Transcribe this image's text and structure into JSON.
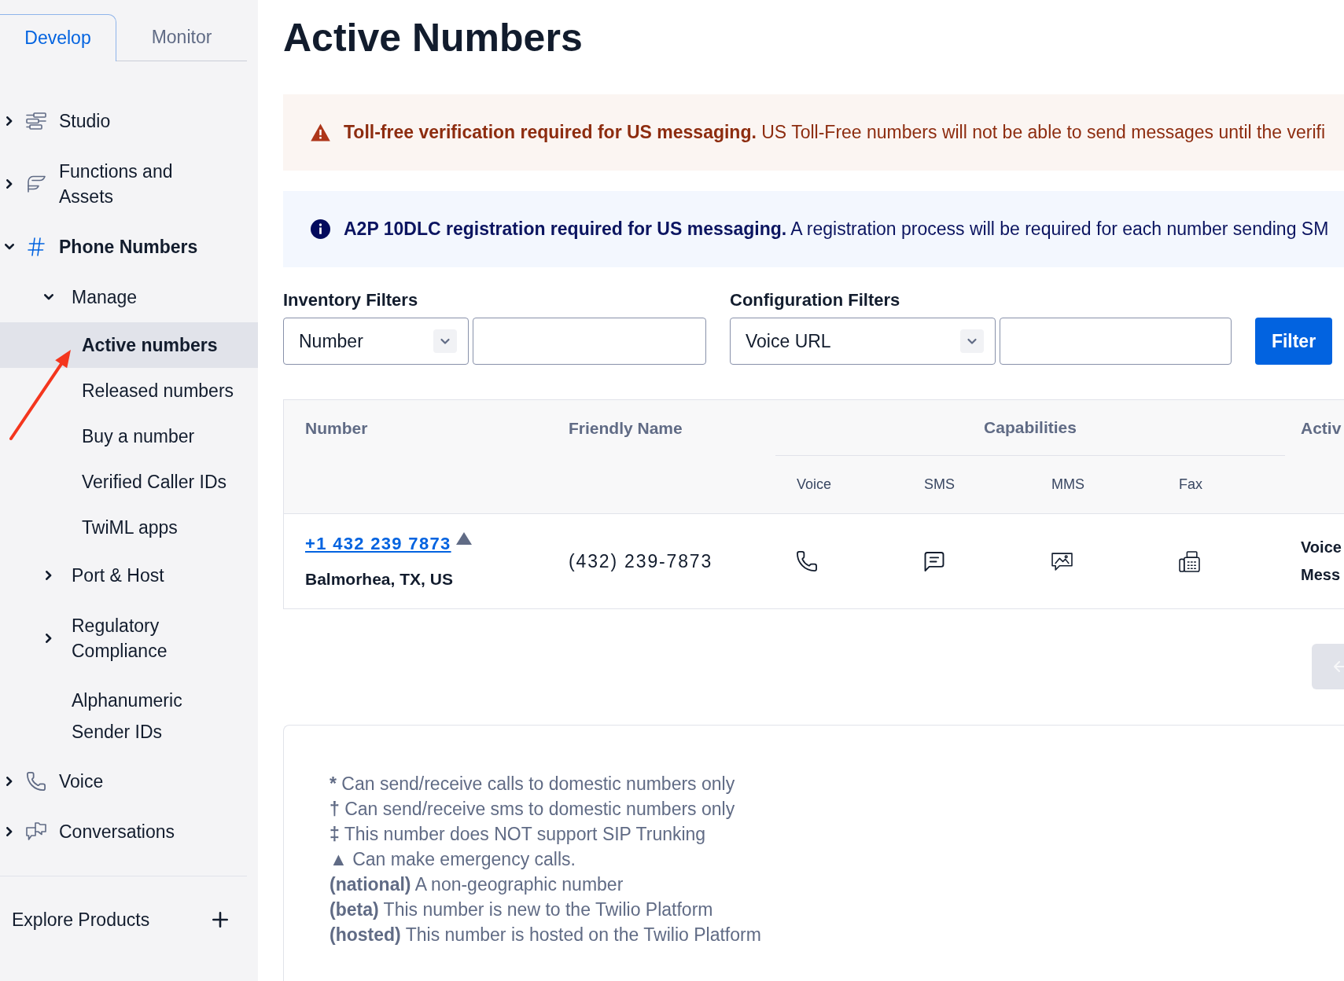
{
  "sidebar": {
    "tabs": [
      {
        "label": "Develop",
        "selected": true
      },
      {
        "label": "Monitor",
        "selected": false
      }
    ],
    "items": [
      {
        "label": "Studio",
        "selected": false,
        "expanded": false
      },
      {
        "label": "Functions and Assets",
        "selected": false,
        "expanded": false
      },
      {
        "label": "Phone Numbers",
        "selected": true,
        "expanded": true,
        "children": [
          {
            "kind": "group",
            "label": "Manage",
            "selected": false,
            "expanded": true,
            "children": [
              {
                "label": "Active numbers",
                "selected": true
              },
              {
                "label": "Released numbers",
                "selected": false
              },
              {
                "label": "Buy a number",
                "selected": false
              },
              {
                "label": "Verified Caller IDs",
                "selected": false
              },
              {
                "label": "TwiML apps",
                "selected": false
              }
            ]
          },
          {
            "kind": "group",
            "label": "Port & Host",
            "selected": false,
            "expanded": false
          },
          {
            "kind": "group",
            "label": "Regulatory Compliance",
            "selected": false,
            "expanded": false
          },
          {
            "kind": "link",
            "label": "Alphanumeric Sender IDs",
            "selected": false
          }
        ]
      },
      {
        "label": "Voice",
        "selected": false,
        "expanded": false
      },
      {
        "label": "Conversations",
        "selected": false,
        "expanded": false
      }
    ],
    "footer": {
      "label": "Explore Products"
    }
  },
  "page_title": "Active Numbers",
  "alerts": [
    {
      "kind": "warning",
      "message": "**Toll-free verification required for US messaging.** US Toll-Free numbers will not be able to send messages until the verifi"
    },
    {
      "kind": "info",
      "message": "**A2P 10DLC registration required for US messaging.** A registration process will be required for each number sending SM"
    }
  ],
  "filters": {
    "groups": [
      {
        "label": "Inventory Filters",
        "select_value": "Number"
      },
      {
        "label": "Configuration Filters",
        "select_value": "Voice URL"
      }
    ],
    "button": "Filter"
  },
  "table": {
    "columns": [
      {
        "label": "Number"
      },
      {
        "label": "Friendly Name"
      },
      {
        "label": "Capabilities",
        "subcolumns": [
          "Voice",
          "SMS",
          "MMS",
          "Fax"
        ]
      },
      {
        "label": "Activ"
      }
    ],
    "rows": [
      {
        "number": "+1 432 239 7873",
        "emergency": true,
        "location": "Balmorhea, TX, US",
        "friendly_name": "(432) 239-7873",
        "capabilities": [
          {
            "kind": "voice",
            "available": true
          },
          {
            "kind": "sms",
            "available": true
          },
          {
            "kind": "mms",
            "available": true
          },
          {
            "kind": "fax",
            "available": true
          }
        ],
        "column_4": [
          "Voice",
          "Mess"
        ]
      }
    ]
  },
  "pagination": {
    "previous_button": {
      "disabled": true
    }
  },
  "legend": [
    {
      "mark": "*",
      "text": "Can send/receive calls to domestic numbers only"
    },
    {
      "mark": "†",
      "text": "Can send/receive sms to domestic numbers only"
    },
    {
      "mark": "‡",
      "text": "This number does NOT support SIP Trunking"
    },
    {
      "mark": "▲",
      "text": "Can make emergency calls."
    },
    {
      "mark": "(national)",
      "text": "A non-geographic number"
    },
    {
      "mark": "(beta)",
      "text": "This number is new to the Twilio Platform"
    },
    {
      "mark": "(hosted)",
      "text": "This number is hosted on the Twilio Platform"
    }
  ]
}
